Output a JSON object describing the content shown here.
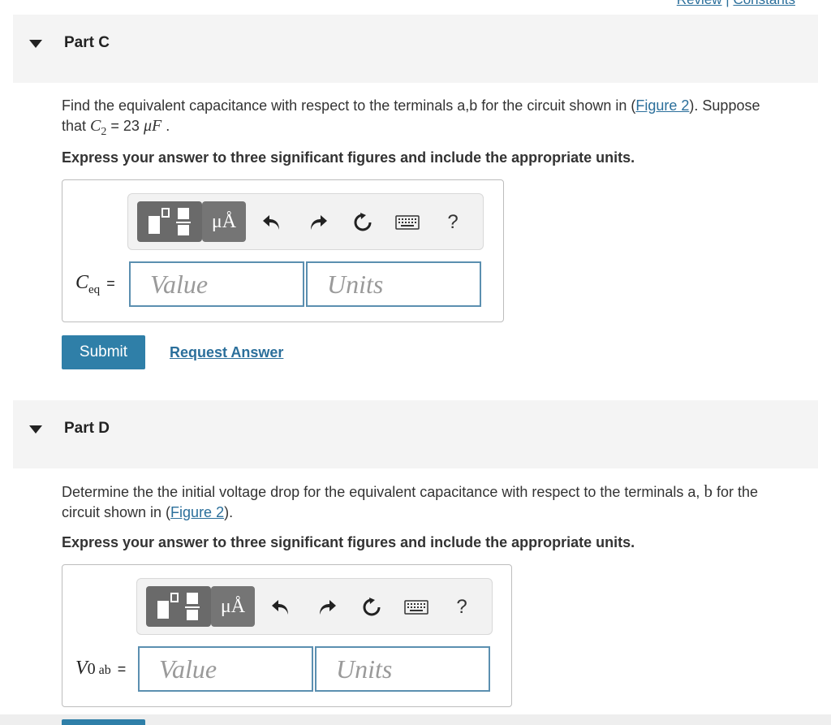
{
  "top_links": {
    "review": "Review",
    "separator": "|",
    "constants": "Constants"
  },
  "part_c": {
    "title": "Part C",
    "q_before": "Find the equivalent capacitance with respect to the terminals a,b for the circuit shown in (",
    "figure_link": "Figure 2",
    "q_after": "). Suppose",
    "q_line2_prefix": "that",
    "c2_var": "C",
    "c2_sub": "2",
    "c2_value": "= 23",
    "c2_unit": "μF",
    "q_end": ".",
    "instruction": "Express your answer to three significant figures and include the appropriate units.",
    "toolbar": {
      "mu_label": "μÅ",
      "help_label": "?"
    },
    "var_symbol": "C",
    "var_sub": "eq",
    "equals": "=",
    "value_placeholder": "Value",
    "units_placeholder": "Units",
    "submit_label": "Submit",
    "request_label": "Request Answer"
  },
  "part_d": {
    "title": "Part D",
    "q_line1": "Determine the the initial voltage drop for the equivalent capacitance with respect to the terminals a,",
    "q_b": "b",
    "q_for": "for the",
    "q_line2_before": "circuit shown in (",
    "figure_link": "Figure 2",
    "q_line2_after": ").",
    "instruction": "Express your answer to three significant figures and include the appropriate units.",
    "toolbar": {
      "mu_label": "μÅ",
      "help_label": "?"
    },
    "var_symbol": "V",
    "var_zero": "0",
    "var_sub": "ab",
    "equals": "=",
    "value_placeholder": "Value",
    "units_placeholder": "Units"
  }
}
